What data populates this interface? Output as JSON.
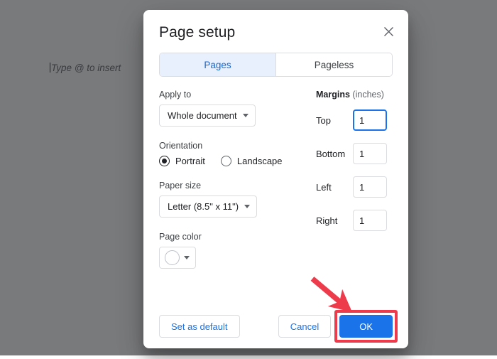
{
  "background": {
    "placeholder_text": "Type @ to insert"
  },
  "dialog": {
    "title": "Page setup",
    "close_icon": "close-icon",
    "tabs": [
      {
        "label": "Pages",
        "active": true
      },
      {
        "label": "Pageless",
        "active": false
      }
    ],
    "apply_to": {
      "label": "Apply to",
      "value": "Whole document"
    },
    "orientation": {
      "label": "Orientation",
      "options": [
        {
          "label": "Portrait",
          "selected": true
        },
        {
          "label": "Landscape",
          "selected": false
        }
      ]
    },
    "paper_size": {
      "label": "Paper size",
      "value": "Letter (8.5\" x 11\")"
    },
    "page_color": {
      "label": "Page color",
      "value_hex": "#ffffff"
    },
    "margins": {
      "title": "Margins",
      "units": "(inches)",
      "rows": [
        {
          "label": "Top",
          "value": "1",
          "focused": true
        },
        {
          "label": "Bottom",
          "value": "1",
          "focused": false
        },
        {
          "label": "Left",
          "value": "1",
          "focused": false
        },
        {
          "label": "Right",
          "value": "1",
          "focused": false
        }
      ]
    },
    "footer": {
      "set_default_label": "Set as default",
      "cancel_label": "Cancel",
      "ok_label": "OK"
    }
  },
  "annotation": {
    "arrow_color": "#ee3b4b",
    "highlight_color": "#ee3b4b",
    "target": "ok-button"
  },
  "colors": {
    "accent_blue": "#1a73e8",
    "tab_active_bg": "#e8f0fe",
    "tab_active_text": "#1967d2",
    "scrim": "#202124"
  }
}
